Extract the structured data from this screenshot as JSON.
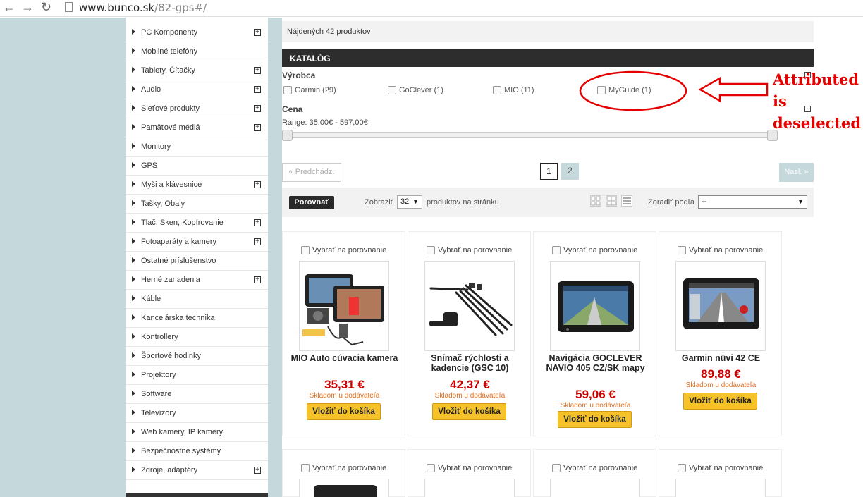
{
  "browser": {
    "url_host": "www.bunco.sk",
    "url_path": "/82-gps#/"
  },
  "sidebar": {
    "items": [
      {
        "label": "PC Komponenty",
        "expandable": true
      },
      {
        "label": "Mobilné telefóny",
        "expandable": false
      },
      {
        "label": "Tablety, Čítačky",
        "expandable": true
      },
      {
        "label": "Audio",
        "expandable": true
      },
      {
        "label": "Sieťové produkty",
        "expandable": true
      },
      {
        "label": "Pamäťové médiá",
        "expandable": true
      },
      {
        "label": "Monitory",
        "expandable": false
      },
      {
        "label": "GPS",
        "expandable": false
      },
      {
        "label": "Myši a klávesnice",
        "expandable": true
      },
      {
        "label": "Tašky, Obaly",
        "expandable": false
      },
      {
        "label": "Tlač, Sken, Kopírovanie",
        "expandable": true
      },
      {
        "label": "Fotoaparáty a kamery",
        "expandable": true
      },
      {
        "label": "Ostatné príslušenstvo",
        "expandable": false
      },
      {
        "label": "Herné zariadenia",
        "expandable": true
      },
      {
        "label": "Káble",
        "expandable": false
      },
      {
        "label": "Kancelárska technika",
        "expandable": false
      },
      {
        "label": "Kontrollery",
        "expandable": false
      },
      {
        "label": "Športové hodinky",
        "expandable": false
      },
      {
        "label": "Projektory",
        "expandable": false
      },
      {
        "label": "Software",
        "expandable": false
      },
      {
        "label": "Televízory",
        "expandable": false
      },
      {
        "label": "Web kamery, IP kamery",
        "expandable": false
      },
      {
        "label": "Bezpečnostné systémy",
        "expandable": false
      },
      {
        "label": "Zdroje, adaptéry",
        "expandable": true
      }
    ],
    "plus_glyph": "+"
  },
  "main": {
    "found_text": "Nájdených 42 produktov",
    "katalog_title": "KATALÓG",
    "collapse_glyph": "-",
    "manufacturer": {
      "title": "Výrobca",
      "options": [
        {
          "label": "Garmin (29)",
          "checked": false
        },
        {
          "label": "GoClever (1)",
          "checked": false
        },
        {
          "label": "MIO (11)",
          "checked": false
        },
        {
          "label": "MyGuide (1)",
          "checked": false
        }
      ]
    },
    "price": {
      "title": "Cena",
      "range_text": "Range: 35,00€ - 597,00€"
    },
    "pager": {
      "prev": "« Predchádz.",
      "next": "Nasl. »",
      "pages": [
        "1",
        "2"
      ],
      "current": "1"
    },
    "toolbar": {
      "compare": "Porovnať",
      "show_label": "Zobraziť",
      "per_page_value": "32",
      "per_page_suffix": "produktov na stránku",
      "sort_label": "Zoradiť podľa",
      "sort_value": "--",
      "dropdown_arrow": "▼"
    },
    "compare_label": "Vybrať na porovnanie",
    "products": [
      {
        "name": "MIO Auto cúvacia kamera",
        "price": "35,31 €",
        "stock": "Skladom u dodávateľa",
        "cart": "Vložiť do košíka"
      },
      {
        "name": "Snímač rýchlosti a kadencie (GSC 10)",
        "price": "42,37 €",
        "stock": "Skladom u dodávateľa",
        "cart": "Vložiť do košíka"
      },
      {
        "name": "Navigácia GOCLEVER NAVIO 405 CZ/SK mapy",
        "price": "59,06 €",
        "stock": "Skladom u dodávateľa",
        "cart": "Vložiť do košíka"
      },
      {
        "name": "Garmin nüvi 42 CE",
        "price": "89,88 €",
        "stock": "Skladom u dodávateľa",
        "cart": "Vložiť do košíka"
      }
    ]
  },
  "annotation": {
    "lines": [
      "Attributed",
      "is",
      "deselected"
    ],
    "color": "#e50000"
  }
}
